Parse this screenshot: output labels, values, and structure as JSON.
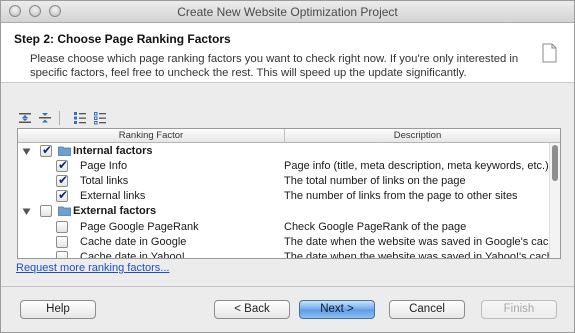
{
  "window": {
    "title": "Create New Website Optimization Project"
  },
  "header": {
    "step_title": "Step 2: Choose Page Ranking Factors",
    "description": "Please choose which page ranking factors you want to check right now. If you're only interested in specific factors, feel free to uncheck the rest. This will speed up the update significantly."
  },
  "toolbar": {
    "icons": [
      "expand-all-icon",
      "collapse-all-icon",
      "check-all-icon",
      "uncheck-all-icon"
    ]
  },
  "table": {
    "columns": [
      "Ranking Factor",
      "Description"
    ],
    "rows": [
      {
        "group": true,
        "expanded": true,
        "checked": true,
        "label": "Internal factors",
        "desc": ""
      },
      {
        "group": false,
        "checked": true,
        "label": "Page Info",
        "desc": "Page info (title, meta description, meta keywords, etc.)"
      },
      {
        "group": false,
        "checked": true,
        "label": "Total links",
        "desc": "The total number of links on the page"
      },
      {
        "group": false,
        "checked": true,
        "label": "External links",
        "desc": "The number of links from the page to other sites"
      },
      {
        "group": true,
        "expanded": true,
        "checked": false,
        "label": "External factors",
        "desc": ""
      },
      {
        "group": false,
        "checked": false,
        "label": "Page Google PageRank",
        "desc": "Check Google PageRank of the page"
      },
      {
        "group": false,
        "checked": false,
        "label": "Cache date in Google",
        "desc": "The date when the website was saved in Google's cache."
      },
      {
        "group": false,
        "checked": false,
        "label": "Cache date in Yahoo!",
        "desc": "The date when the website was saved in Yahoo!'s cache."
      }
    ]
  },
  "links": {
    "more_factors": "Request more ranking factors..."
  },
  "buttons": {
    "help": "Help",
    "back": "< Back",
    "next": "Next >",
    "cancel": "Cancel",
    "finish": "Finish"
  },
  "colors": {
    "accent": "#5c9be4",
    "link": "#1f4fbf",
    "folder": "#6d9fd1"
  }
}
